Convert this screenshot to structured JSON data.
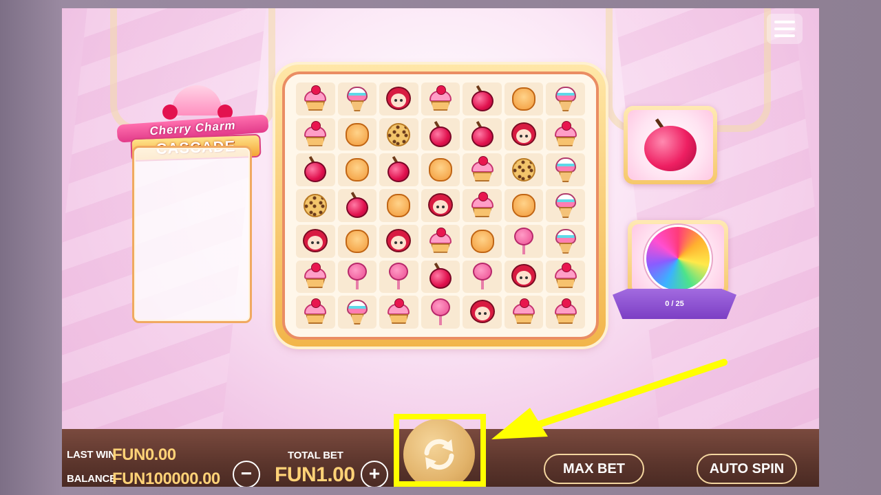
{
  "game": {
    "logo_line1": "Cherry Charm",
    "logo_line2": "CASCADE"
  },
  "grid": {
    "rows": [
      [
        "cupcake",
        "icecream",
        "girl",
        "cupcake",
        "cherry",
        "puff",
        "icecream"
      ],
      [
        "cupcake",
        "puff",
        "cookie",
        "cherry",
        "cherry",
        "girl",
        "cupcake"
      ],
      [
        "cherry",
        "puff",
        "cherry",
        "puff",
        "cupcake",
        "cookie",
        "icecream"
      ],
      [
        "cookie",
        "cherry",
        "puff",
        "girl",
        "cupcake",
        "puff",
        "icecream"
      ],
      [
        "girl",
        "puff",
        "girl",
        "cupcake",
        "puff",
        "cotton",
        "icecream"
      ],
      [
        "cupcake",
        "cotton",
        "cotton",
        "cherry",
        "cotton",
        "girl",
        "cupcake"
      ],
      [
        "cupcake",
        "icecream",
        "cupcake",
        "cotton",
        "girl",
        "cupcake",
        "cupcake"
      ]
    ]
  },
  "side": {
    "target_symbol": "cherry",
    "feature_symbol": "lollipop",
    "progress_text": "0 / 25",
    "progress": 0
  },
  "bottom_bar": {
    "last_win_label": "LAST WIN",
    "last_win_value": "FUN0.00",
    "balance_label": "BALANCE",
    "balance_value": "FUN100000.00",
    "total_bet_label": "TOTAL BET",
    "total_bet_value": "FUN1.00",
    "minus_label": "−",
    "plus_label": "+",
    "max_bet_label": "MAX BET",
    "auto_spin_label": "AUTO SPIN"
  },
  "colors": {
    "highlight": "#ffff00",
    "value_text": "#ffd277"
  }
}
